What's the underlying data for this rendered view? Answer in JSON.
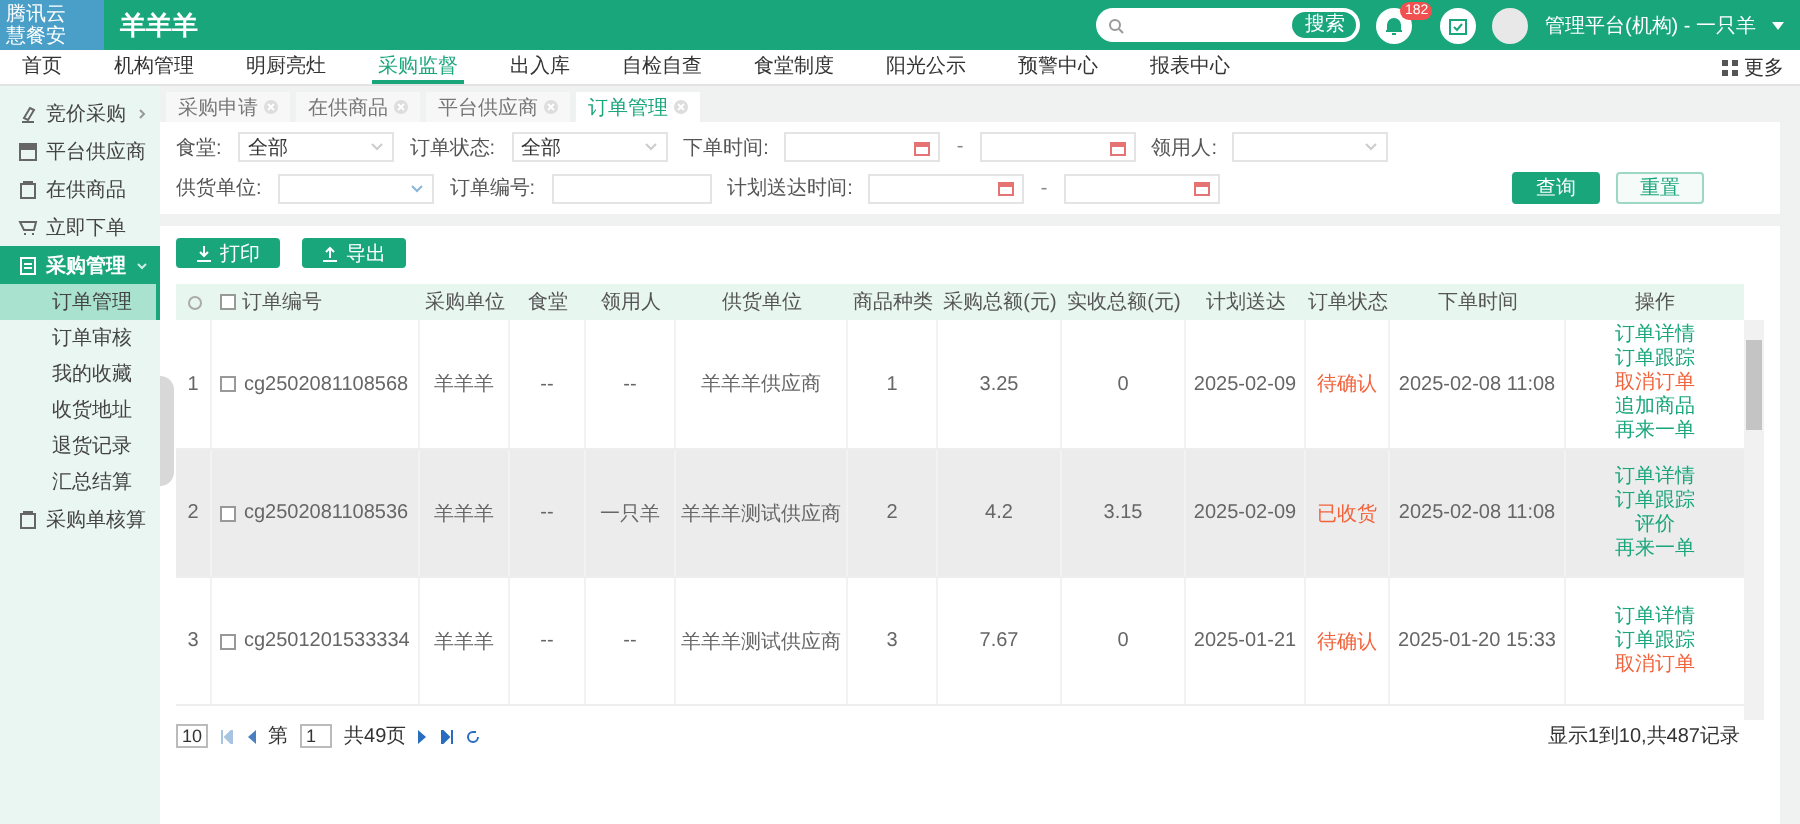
{
  "header": {
    "logo_lines": [
      "腾讯云",
      "慧餐安"
    ],
    "title": "羊羊羊",
    "search": {
      "button": "搜索"
    },
    "notifications": "182",
    "user": "管理平台(机构) - 一只羊"
  },
  "nav": {
    "items": [
      {
        "label": "首页",
        "selected": false
      },
      {
        "label": "机构管理",
        "selected": false
      },
      {
        "label": "明厨亮灶",
        "selected": false
      },
      {
        "label": "采购监督",
        "selected": true
      },
      {
        "label": "出入库",
        "selected": false
      },
      {
        "label": "自检自查",
        "selected": false
      },
      {
        "label": "食堂制度",
        "selected": false
      },
      {
        "label": "阳光公示",
        "selected": false
      },
      {
        "label": "预警中心",
        "selected": false
      },
      {
        "label": "报表中心",
        "selected": false
      }
    ],
    "more": "更多"
  },
  "sidebar": {
    "items": [
      {
        "label": "竞价采购",
        "selected": false,
        "expanded": false
      },
      {
        "label": "平台供应商",
        "selected": false
      },
      {
        "label": "在供商品",
        "selected": false
      },
      {
        "label": "立即下单",
        "selected": false
      },
      {
        "label": "采购管理",
        "selected": true,
        "expanded": true,
        "children": [
          {
            "label": "订单管理",
            "selected": true
          },
          {
            "label": "订单审核",
            "selected": false
          },
          {
            "label": "我的收藏",
            "selected": false
          },
          {
            "label": "收货地址",
            "selected": false
          },
          {
            "label": "退货记录",
            "selected": false
          },
          {
            "label": "汇总结算",
            "selected": false
          }
        ]
      },
      {
        "label": "采购单核算",
        "selected": false
      }
    ]
  },
  "tabs": [
    {
      "label": "采购申请",
      "selected": false
    },
    {
      "label": "在供商品",
      "selected": false
    },
    {
      "label": "平台供应商",
      "selected": false
    },
    {
      "label": "订单管理",
      "selected": true
    }
  ],
  "filters": [
    [
      {
        "kind": "select",
        "label": "食堂:",
        "value": "全部"
      },
      {
        "kind": "select",
        "label": "订单状态:",
        "value": "全部"
      },
      {
        "kind": "daterange",
        "label": "下单时间:",
        "separator": "-"
      },
      {
        "kind": "select",
        "label": "领用人:"
      }
    ],
    [
      {
        "kind": "select",
        "label": "供货单位:"
      },
      {
        "kind": "input",
        "label": "订单编号:"
      },
      {
        "kind": "daterange",
        "label": "计划送达时间:",
        "separator": "-"
      }
    ]
  ],
  "filter_buttons": [
    {
      "label": "查询",
      "kind": "primary"
    },
    {
      "label": "重置",
      "kind": "secondary"
    }
  ],
  "toolbar": [
    {
      "label": "打印",
      "kind": "print"
    },
    {
      "label": "导出",
      "kind": "export"
    }
  ],
  "table": {
    "header_checked": false,
    "columns": [
      "订单编号",
      "采购单位",
      "食堂",
      "领用人",
      "供货单位",
      "商品种类",
      "采购总额(元)",
      "实收总额(元)",
      "计划送达",
      "订单状态",
      "下单时间",
      "操作"
    ],
    "rows": [
      {
        "index": "1",
        "checked": false,
        "hovered": false,
        "cells": [
          "cg2502081108568",
          "羊羊羊",
          "--",
          "--",
          "羊羊羊供应商",
          "1",
          "3.25",
          "0",
          "2025-02-09",
          "待确认",
          "2025-02-08 11:08"
        ],
        "actions": [
          {
            "label": "订单详情",
            "kind": "normal"
          },
          {
            "label": "订单跟踪",
            "kind": "normal"
          },
          {
            "label": "取消订单",
            "kind": "danger"
          },
          {
            "label": "追加商品",
            "kind": "normal"
          },
          {
            "label": "再来一单",
            "kind": "normal"
          }
        ]
      },
      {
        "index": "2",
        "checked": false,
        "hovered": true,
        "cells": [
          "cg2502081108536",
          "羊羊羊",
          "--",
          "一只羊",
          "羊羊羊测试供应商",
          "2",
          "4.2",
          "3.15",
          "2025-02-09",
          "已收货",
          "2025-02-08 11:08"
        ],
        "actions": [
          {
            "label": "订单详情",
            "kind": "normal"
          },
          {
            "label": "订单跟踪",
            "kind": "normal"
          },
          {
            "label": "评价",
            "kind": "normal"
          },
          {
            "label": "再来一单",
            "kind": "normal"
          }
        ]
      },
      {
        "index": "3",
        "checked": false,
        "hovered": false,
        "cells": [
          "cg2501201533334",
          "羊羊羊",
          "--",
          "--",
          "羊羊羊测试供应商",
          "3",
          "7.67",
          "0",
          "2025-01-21",
          "待确认",
          "2025-01-20 15:33"
        ],
        "actions": [
          {
            "label": "订单详情",
            "kind": "normal"
          },
          {
            "label": "订单跟踪",
            "kind": "normal"
          },
          {
            "label": "取消订单",
            "kind": "danger"
          }
        ]
      }
    ]
  },
  "pagination": {
    "page_size": "10",
    "page_prefix": "第",
    "page": "1",
    "total_pages": "共49页",
    "summary": "显示1到10,共487记录"
  }
}
